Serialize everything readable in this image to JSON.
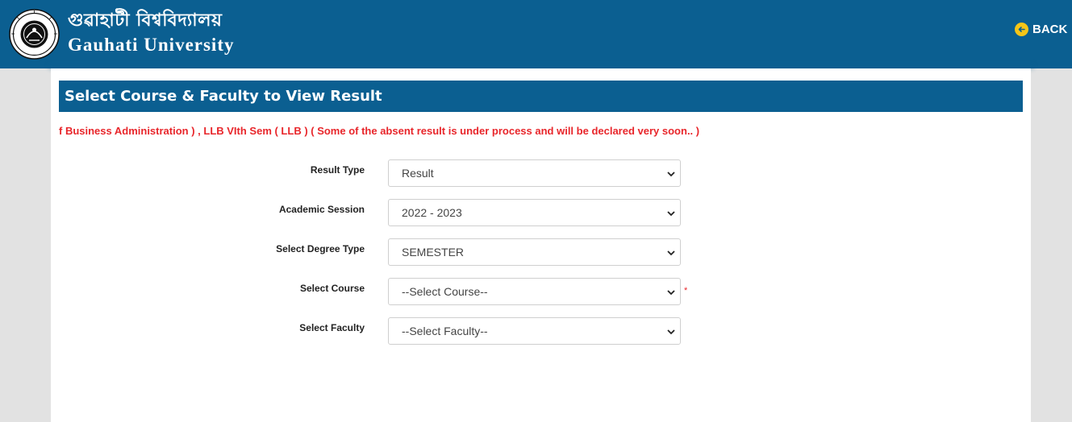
{
  "header": {
    "title_bn": "গুৱাহাটী বিশ্ববিদ্যালয়",
    "title_en": "Gauhati University",
    "back_label": "BACK",
    "logo_icon": "university-seal-icon",
    "back_icon": "arrow-left-circle-icon"
  },
  "panel": {
    "title": "Select Course & Faculty to View Result",
    "notice": "f Business Administration ) , LLB VIth Sem ( LLB ) ( Some of the absent result is under process and will be declared very soon.. )"
  },
  "form": {
    "result_type": {
      "label": "Result Type",
      "value": "Result"
    },
    "academic_session": {
      "label": "Academic Session",
      "value": "2022 - 2023"
    },
    "degree_type": {
      "label": "Select Degree Type",
      "value": "SEMESTER"
    },
    "course": {
      "label": "Select Course",
      "value": "--Select Course--",
      "required_mark": "*"
    },
    "faculty": {
      "label": "Select Faculty",
      "value": "--Select Faculty--"
    }
  },
  "colors": {
    "brand": "#0b5f91",
    "notice": "#e8262b",
    "back_icon": "#f5c518"
  }
}
